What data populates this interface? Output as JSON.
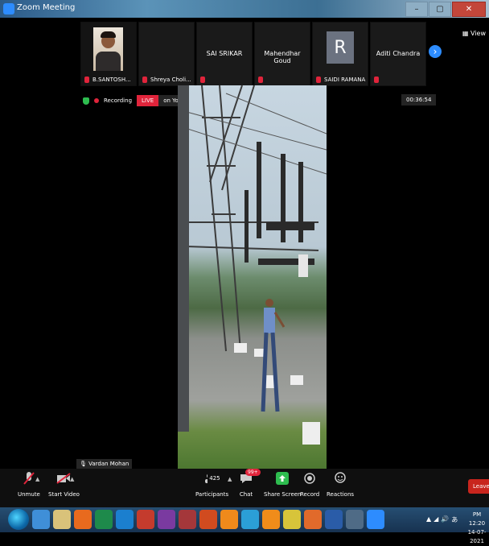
{
  "window": {
    "title": "Zoom Meeting"
  },
  "colors": {
    "accent": "#2d8cff",
    "live_red": "#e0243b",
    "leave_red": "#c8251d"
  },
  "participants": [
    {
      "name": "B.SANTOSH...",
      "muted": true,
      "tile": "photo"
    },
    {
      "name": "Shreya Choli...",
      "muted": true,
      "tile": "blank"
    },
    {
      "name": "SAI SRIKAR",
      "muted": true,
      "tile": "name"
    },
    {
      "name": "Mahendhar Goud",
      "muted": true,
      "tile": "name"
    },
    {
      "name": "SAIDI RAMANA",
      "muted": true,
      "tile": "letter",
      "letter": "R"
    },
    {
      "name": "Aditi Chandra",
      "muted": true,
      "tile": "name"
    }
  ],
  "top_right": {
    "view_label": "View"
  },
  "status": {
    "recording": "Recording",
    "live": "LIVE",
    "platform": "on YouTube"
  },
  "timer": "00:36:54",
  "active_speaker": "Vardan Mohan",
  "toolbar": {
    "unmute": "Unmute",
    "start_video": "Start Video",
    "participants": "Participants",
    "participants_count": "425",
    "chat": "Chat",
    "chat_badge": "99+",
    "share_screen": "Share Screen",
    "record": "Record",
    "reactions": "Reactions",
    "leave": "Leave"
  },
  "taskbar": {
    "apps": [
      "ie",
      "outlook",
      "notes",
      "q",
      "excel",
      "edge",
      "ppt",
      "onenote",
      "access",
      "pdf",
      "firefox",
      "zoom",
      "vlc",
      "chrome",
      "matlab",
      "word",
      "outlook2",
      "zoom2"
    ],
    "tray": [
      "▲",
      "◢",
      "🔊",
      "あ"
    ],
    "time": "PM 12:20",
    "date": "14-07-2021"
  }
}
